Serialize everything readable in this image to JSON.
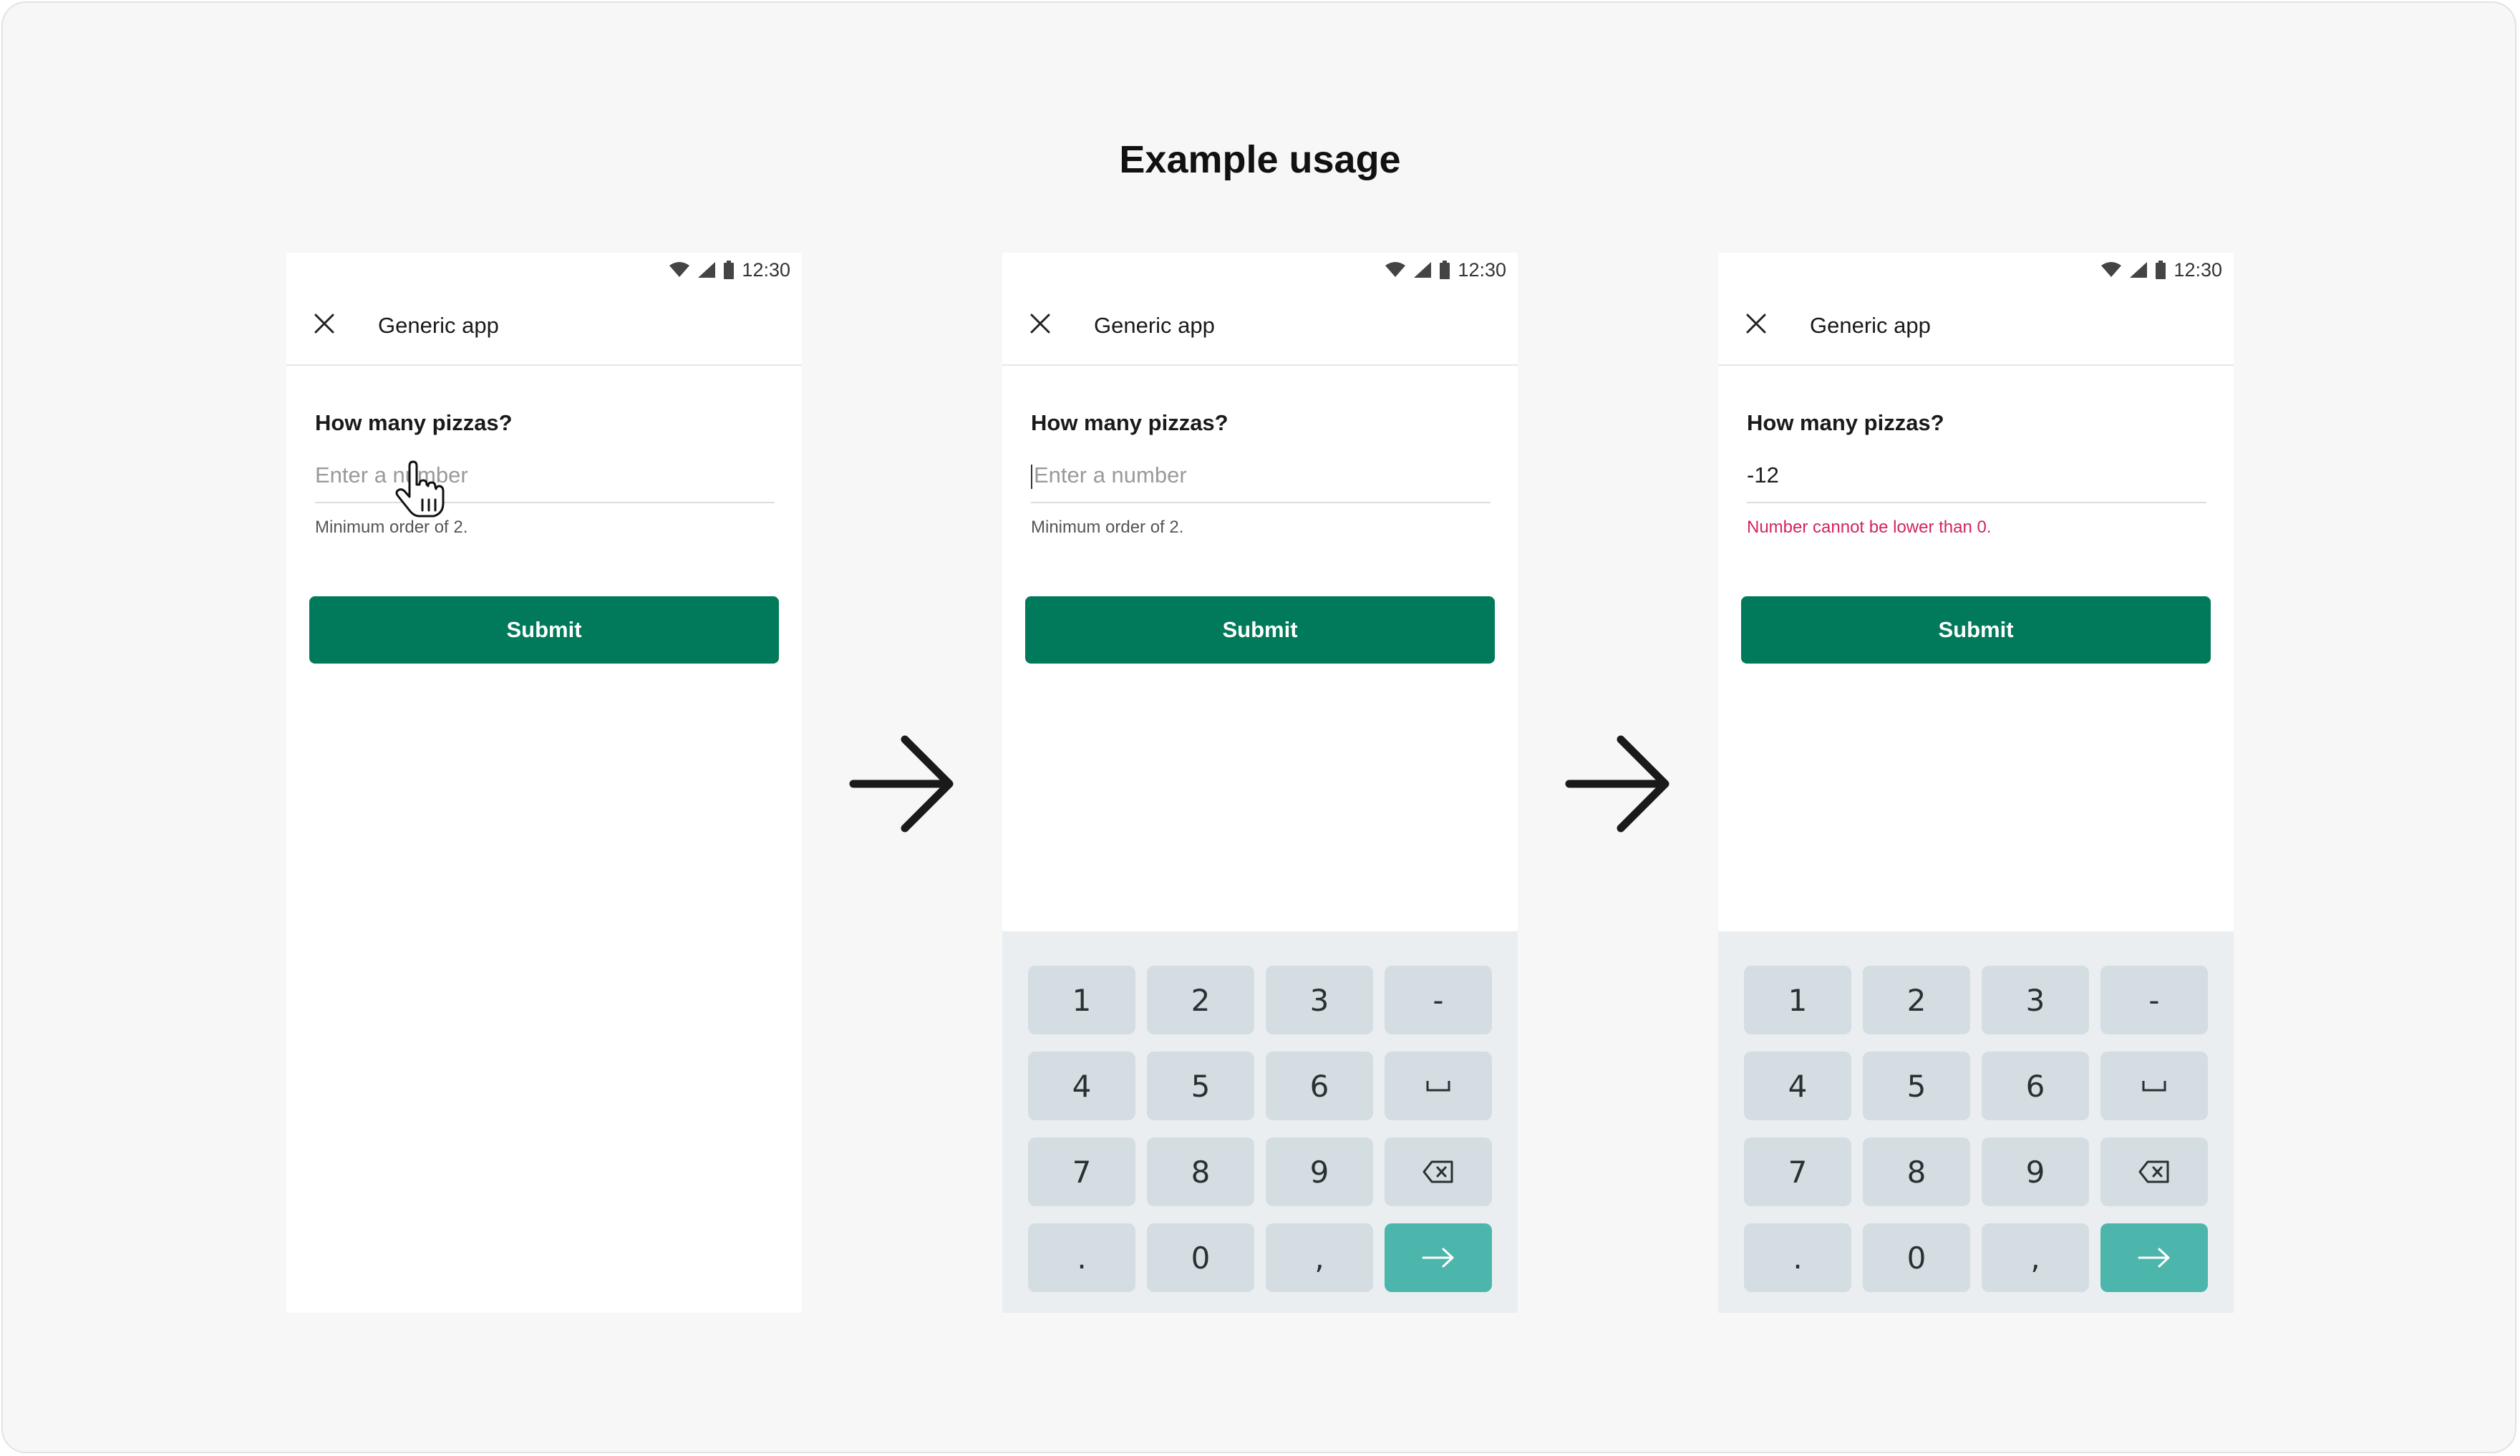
{
  "page": {
    "title": "Example usage"
  },
  "status": {
    "time": "12:30"
  },
  "screens": [
    {
      "app_title": "Generic app",
      "question": "How many pizzas?",
      "input": {
        "value": "",
        "placeholder": "Enter a number",
        "state": "hover"
      },
      "helper": "Minimum order of 2.",
      "submit_label": "Submit"
    },
    {
      "app_title": "Generic app",
      "question": "How many pizzas?",
      "input": {
        "value": "",
        "placeholder": "Enter a number",
        "state": "focused"
      },
      "helper": "Minimum order of 2.",
      "submit_label": "Submit"
    },
    {
      "app_title": "Generic app",
      "question": "How many pizzas?",
      "input": {
        "value": "-12",
        "placeholder": "Enter a number",
        "state": "error"
      },
      "helper": "Number cannot be lower than 0.",
      "submit_label": "Submit"
    }
  ],
  "keypad": {
    "keys": [
      "1",
      "2",
      "3",
      "-",
      "4",
      "5",
      "6",
      "space",
      "7",
      "8",
      "9",
      "backspace",
      ".",
      "0",
      ",",
      "enter"
    ]
  },
  "colors": {
    "primary_button": "#007a5a",
    "enter_key": "#4db6ac",
    "key": "#d3dde2",
    "keypad_bg": "#ebeef0",
    "error_text": "#d4245c"
  },
  "icons": {
    "close": "close-icon",
    "wifi": "wifi-icon",
    "signal": "signal-icon",
    "battery": "battery-icon",
    "cursor": "hand-cursor-icon",
    "flow_arrow": "arrow-right-icon"
  }
}
